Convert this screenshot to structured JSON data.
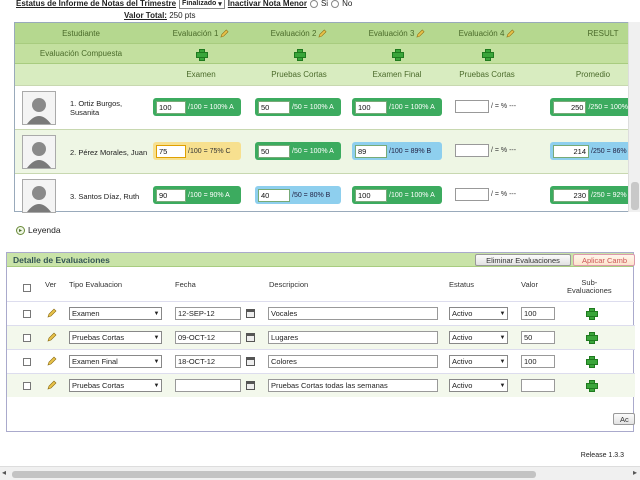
{
  "header": {
    "estatus_label": "Estatus de Informe de Notas del Trimestre",
    "estatus_value": "Finalizado",
    "inactivar_label": "Inactivar Nota Menor",
    "si": "Si",
    "no": "No",
    "valor_total_label": "Valor Total:",
    "valor_total_value": "250 pts"
  },
  "grades": {
    "col_estudiante": "Estudiante",
    "evaluations": [
      "Evaluación 1",
      "Evaluación 2",
      "Evaluación 3",
      "Evaluación 4"
    ],
    "result_label": "RESULT",
    "compuesta_label": "Evaluación Compuesta",
    "sub_headers": [
      "Examen",
      "Pruebas Cortas",
      "Examen Final",
      "Pruebas Cortas",
      "Promedio"
    ],
    "students": [
      {
        "name": "1. Ortiz Burgos, Susanita",
        "g1": {
          "value": "100",
          "suffix": "/100 = 100% A"
        },
        "g2": {
          "value": "50",
          "suffix": "/50 = 100% A"
        },
        "g3": {
          "value": "100",
          "suffix": "/100 = 100% A"
        },
        "g4": {
          "suffix": "/ = % ---"
        },
        "avg": {
          "value": "250",
          "suffix": "/250 = 100%"
        }
      },
      {
        "name": "2. Pérez Morales, Juan",
        "g1": {
          "value": "75",
          "suffix": "/100 = 75% C"
        },
        "g2": {
          "value": "50",
          "suffix": "/50 = 100% A"
        },
        "g3": {
          "value": "89",
          "suffix": "/100 = 89% B"
        },
        "g4": {
          "suffix": "/ = % ---"
        },
        "avg": {
          "value": "214",
          "suffix": "/250 = 86%"
        }
      },
      {
        "name": "3. Santos Díaz, Ruth",
        "g1": {
          "value": "90",
          "suffix": "/100 = 90% A"
        },
        "g2": {
          "value": "40",
          "suffix": "/50 = 80% B"
        },
        "g3": {
          "value": "100",
          "suffix": "/100 = 100% A"
        },
        "g4": {
          "suffix": "/ = % ---"
        },
        "avg": {
          "value": "230",
          "suffix": "/250 = 92%"
        }
      }
    ]
  },
  "leyenda": "Leyenda",
  "detalle": {
    "title": "Detalle de Evaluaciones",
    "eliminar": "Eliminar Evaluaciones",
    "aplicar": "Aplicar Camb",
    "columns": {
      "ver": "Ver",
      "tipo": "Tipo Evaluacion",
      "fecha": "Fecha",
      "descripcion": "Descripcion",
      "estatus": "Estatus",
      "valor": "Valor",
      "sub_eval_1": "Sub-",
      "sub_eval_2": "Evaluaciones"
    },
    "rows": [
      {
        "tipo": "Examen",
        "fecha": "12-SEP-12",
        "descripcion": "Vocales",
        "estatus": "Activo",
        "valor": "100"
      },
      {
        "tipo": "Pruebas Cortas",
        "fecha": "09-OCT-12",
        "descripcion": "Lugares",
        "estatus": "Activo",
        "valor": "50"
      },
      {
        "tipo": "Examen Final",
        "fecha": "18-OCT-12",
        "descripcion": "Colores",
        "estatus": "Activo",
        "valor": "100"
      },
      {
        "tipo": "Pruebas Cortas",
        "fecha": "",
        "descripcion": "Pruebas Cortas todas las semanas",
        "estatus": "Activo",
        "valor": ""
      }
    ],
    "bottom_button": "Ac"
  },
  "release": "Release 1.3.3",
  "colors": {
    "green_badge": "#3cab5f",
    "blue_badge": "#8ecfee",
    "yellow_badge": "#f7e08f",
    "header_green": "#b5d88f"
  }
}
